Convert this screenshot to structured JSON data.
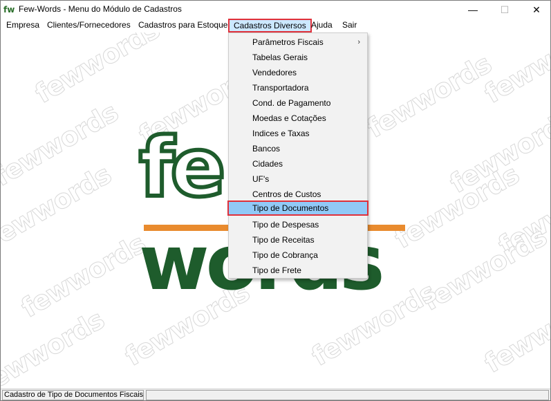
{
  "window": {
    "title": "Few-Words - Menu do Módulo de Cadastros",
    "icon_text": "fw",
    "minimize_glyph": "—",
    "maximize_glyph": "☐",
    "close_glyph": "✕"
  },
  "menubar": {
    "items": [
      {
        "label": "Empresa"
      },
      {
        "label": "Clientes/Fornecedores"
      },
      {
        "label": "Cadastros para Estoque"
      },
      {
        "label": "Cadastros Diversos"
      },
      {
        "label": "Ajuda"
      },
      {
        "label": "Sair"
      }
    ]
  },
  "dropdown": {
    "submenu_arrow": "›",
    "items": [
      {
        "label": "Parâmetros Fiscais"
      },
      {
        "label": "Tabelas Gerais"
      },
      {
        "label": "Vendedores"
      },
      {
        "label": "Transportadora"
      },
      {
        "label": "Cond. de Pagamento"
      },
      {
        "label": "Moedas e Cotações"
      },
      {
        "label": "Indices e Taxas"
      },
      {
        "label": "Bancos"
      },
      {
        "label": "Cidades"
      },
      {
        "label": "UF's"
      },
      {
        "label": "Centros de Custos"
      },
      {
        "label": "Tipo de Documentos"
      },
      {
        "label": "Tipo de Despesas"
      },
      {
        "label": "Tipo de Receitas"
      },
      {
        "label": "Tipo de Cobrança"
      },
      {
        "label": "Tipo de Frete"
      }
    ]
  },
  "logo": {
    "top_text": "fe",
    "bottom_text": "words",
    "watermark_text": "fewwords",
    "green": "#1e5c2c",
    "orange": "#e98b2e"
  },
  "statusbar": {
    "text": "Cadastro de Tipo de Documentos Fiscais"
  },
  "colors": {
    "highlight": "#91c9f7",
    "outline": "#e0303a"
  }
}
